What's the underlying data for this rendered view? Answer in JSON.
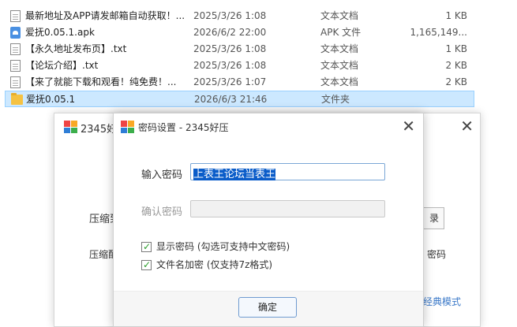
{
  "files": [
    {
      "name": "最新地址及APP请发邮箱自动获取！...",
      "date": "2025/3/26 1:08",
      "type": "文本文档",
      "size": "1 KB",
      "icon": "text-file-icon"
    },
    {
      "name": "爱抚0.05.1.apk",
      "date": "2026/6/2 22:00",
      "type": "APK 文件",
      "size": "1,165,149...",
      "icon": "apk-file-icon"
    },
    {
      "name": "【永久地址发布页】.txt",
      "date": "2025/3/26 1:08",
      "type": "文本文档",
      "size": "1 KB",
      "icon": "text-file-icon"
    },
    {
      "name": "【论坛介绍】.txt",
      "date": "2025/3/26 1:08",
      "type": "文本文档",
      "size": "2 KB",
      "icon": "text-file-icon"
    },
    {
      "name": "【来了就能下载和观看！纯免费！...",
      "date": "2025/3/26 1:07",
      "type": "文本文档",
      "size": "2 KB",
      "icon": "text-file-icon"
    },
    {
      "name": "爱抚0.05.1",
      "date": "2026/6/3 21:46",
      "type": "文件夹",
      "size": "",
      "icon": "folder-icon"
    }
  ],
  "bg_window": {
    "title": "2345好",
    "close": "✕",
    "label1": "压缩到",
    "label2": "压缩配",
    "button_partial": "录",
    "right_text": "密码",
    "link": "经典模式"
  },
  "dialog": {
    "title": "密码设置 - 2345好压",
    "close": "✕",
    "password_label": "输入密码",
    "password_value": "上表王论坛当表王",
    "confirm_label": "确认密码",
    "confirm_value": "",
    "show_password_label": "显示密码 (勾选可支持中文密码)",
    "show_password_checked": true,
    "encrypt_names_label": "文件名加密 (仅支持7z格式)",
    "encrypt_names_checked": true,
    "ok_button": "确定"
  },
  "colors": {
    "selection_bg": "#cce8ff",
    "text_selection": "#0a5cc9",
    "link": "#3a78c8"
  }
}
